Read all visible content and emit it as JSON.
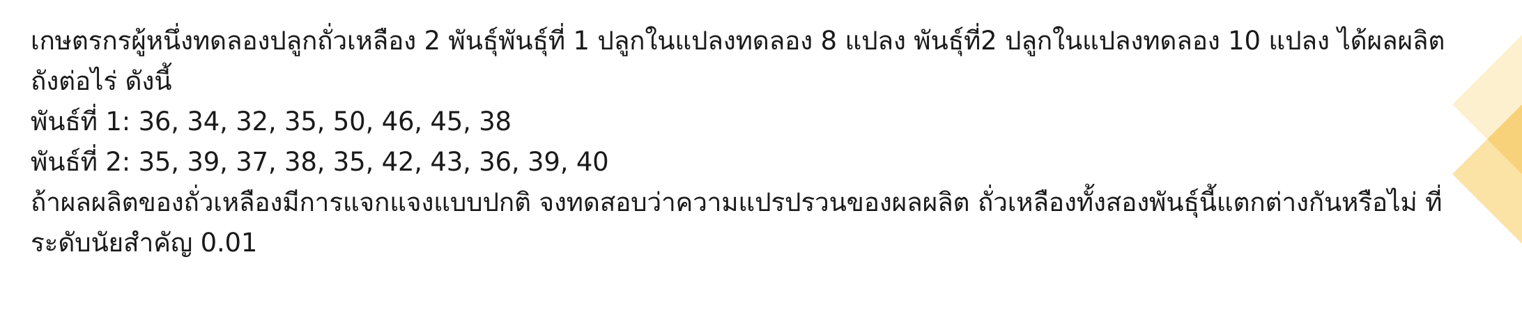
{
  "problem": {
    "intro_line1": "เกษตรกรผู้หนึ่งทดลองปลูกถั่วเหลือง 2 พันธุ์พันธุ์ที่ 1 ปลูกในแปลงทดลอง 8 แปลง พันธุ์ที่2 ปลูกในแปลงทดลอง 10 แปลง ได้ผลผลิต",
    "intro_line2": "ถังต่อไร่ ดังนี้",
    "variety1": "พันธ์ที่ 1: 36, 34, 32, 35, 50, 46, 45, 38",
    "variety2": "พันธ์ที่ 2: 35, 39, 37, 38, 35, 42, 43, 36, 39, 40",
    "question_line1": "ถ้าผลผลิตของถั่วเหลืองมีการแจกแจงแบบปกติ จงทดสอบว่าความแปรปรวนของผลผลิต ถั่วเหลืองทั้งสองพันธุ์นี้แตกต่างกันหรือไม่ ที่",
    "question_line2": "ระดับนัยสำคัญ 0.01"
  },
  "colors": {
    "decoration_light": "#fdf0cf",
    "decoration_mid": "#fbe3a6",
    "decoration_dark": "#f7d27a"
  }
}
